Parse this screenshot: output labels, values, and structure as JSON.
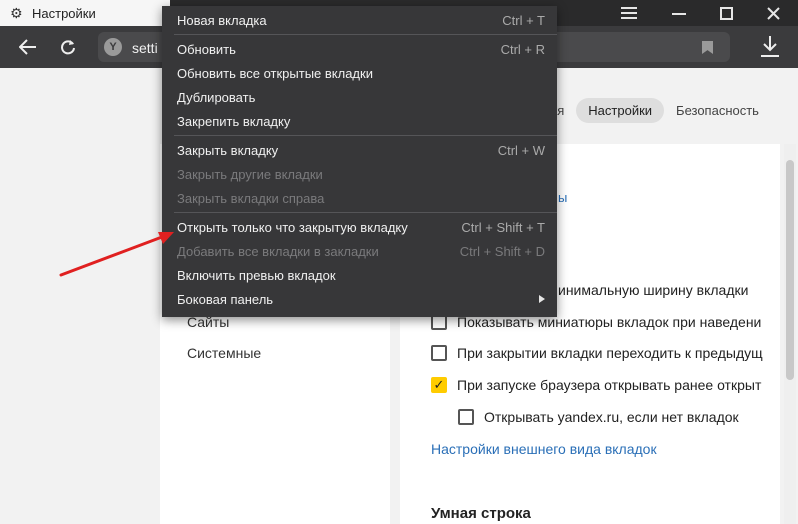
{
  "titlebar": {
    "tab_title": "Настройки",
    "tab_icon": "gear-icon",
    "window_controls": [
      "menu-icon",
      "minimize-icon",
      "maximize-icon",
      "close-icon"
    ]
  },
  "toolbar": {
    "address_text": "setti",
    "site_letter": "Y"
  },
  "settings_tabs": [
    {
      "label": "ая"
    },
    {
      "label": "Настройки",
      "active": true
    },
    {
      "label": "Безопасность"
    }
  ],
  "sidebar": {
    "items": [
      {
        "label": "Сайты"
      },
      {
        "label": "Системные"
      }
    ]
  },
  "content": {
    "fragment_link": "ы",
    "options": [
      {
        "label": "инимальную ширину вкладки",
        "checked": false,
        "partial": true
      },
      {
        "label": "Показывать миниатюры вкладок при наведени",
        "checked": false
      },
      {
        "label": "При закрытии вкладки переходить к предыдущ",
        "checked": false
      },
      {
        "label": "При запуске браузера открывать ранее открыт",
        "checked": true
      },
      {
        "label": "Открывать yandex.ru, если нет вкладок",
        "checked": false,
        "indented": true
      }
    ],
    "appearance_link": "Настройки внешнего вида вкладок",
    "section_title": "Умная строка"
  },
  "context_menu": {
    "items": [
      {
        "label": "Новая вкладка",
        "shortcut": "Ctrl + T",
        "enabled": true
      },
      {
        "separator": true
      },
      {
        "label": "Обновить",
        "shortcut": "Ctrl + R",
        "enabled": true
      },
      {
        "label": "Обновить все открытые вкладки",
        "shortcut": "",
        "enabled": true
      },
      {
        "label": "Дублировать",
        "shortcut": "",
        "enabled": true
      },
      {
        "label": "Закрепить вкладку",
        "shortcut": "",
        "enabled": true
      },
      {
        "separator": true
      },
      {
        "label": "Закрыть вкладку",
        "shortcut": "Ctrl + W",
        "enabled": true
      },
      {
        "label": "Закрыть другие вкладки",
        "shortcut": "",
        "enabled": false
      },
      {
        "label": "Закрыть вкладки справа",
        "shortcut": "",
        "enabled": false
      },
      {
        "separator": true
      },
      {
        "label": "Открыть только что закрытую вкладку",
        "shortcut": "Ctrl + Shift + T",
        "enabled": true,
        "highlighted_by_arrow": true
      },
      {
        "label": "Добавить все вкладки в закладки",
        "shortcut": "Ctrl + Shift + D",
        "enabled": false
      },
      {
        "label": "Включить превью вкладок",
        "shortcut": "",
        "enabled": true
      },
      {
        "label": "Боковая панель",
        "shortcut": "",
        "enabled": true,
        "submenu": true
      }
    ]
  },
  "annotation": {
    "arrow_color": "#e02020"
  },
  "colors": {
    "accent_checkbox": "#ffcc00",
    "link": "#2a6fb7",
    "menu_bg": "#373739"
  }
}
